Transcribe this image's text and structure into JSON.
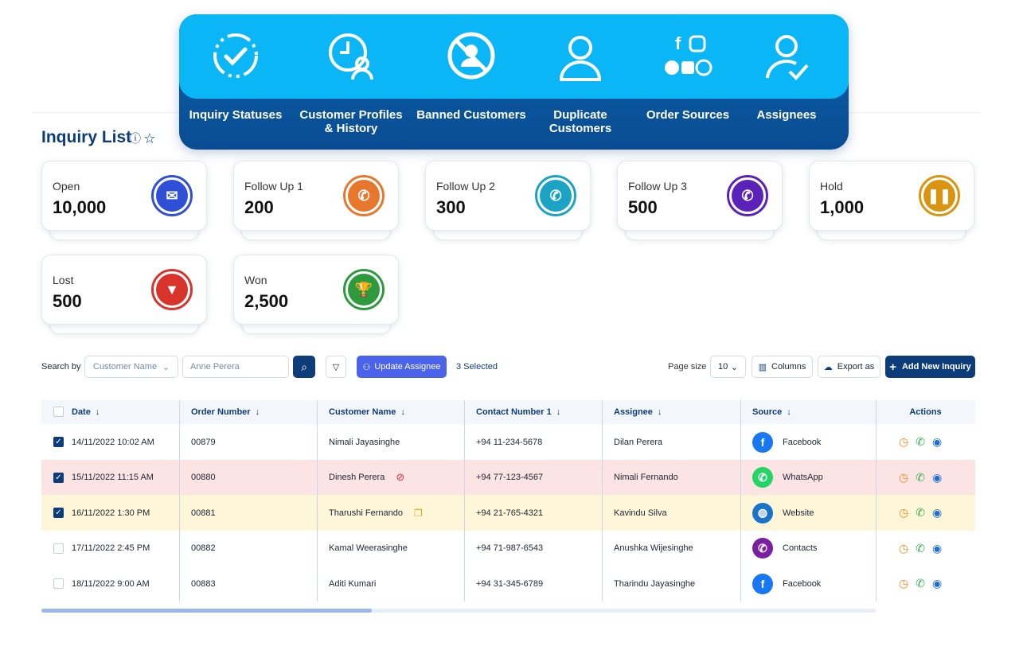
{
  "banner": {
    "items": [
      {
        "label": "Inquiry Statuses",
        "icon": "status-check-icon"
      },
      {
        "label": "Customer Profiles & History",
        "icon": "customer-history-icon"
      },
      {
        "label": "Banned Customers",
        "icon": "banned-user-icon"
      },
      {
        "label": "Duplicate Customers",
        "icon": "duplicate-user-icon"
      },
      {
        "label": "Order Sources",
        "icon": "social-sources-icon"
      },
      {
        "label": "Assignees",
        "icon": "assignee-icon"
      }
    ]
  },
  "page": {
    "title": "Inquiry List"
  },
  "cards": [
    {
      "label": "Open",
      "value": "10,000",
      "color": "#2f4fd6",
      "icon": "envelope-icon"
    },
    {
      "label": "Follow Up 1",
      "value": "200",
      "color": "#e8772e",
      "icon": "phone-icon"
    },
    {
      "label": "Follow Up 2",
      "value": "300",
      "color": "#1aa3c4",
      "icon": "phone-ring-icon"
    },
    {
      "label": "Follow Up 3",
      "value": "500",
      "color": "#5a22b8",
      "icon": "phone-ring-icon"
    },
    {
      "label": "Hold",
      "value": "1,000",
      "color": "#d99512",
      "icon": "pause-icon"
    },
    {
      "label": "Lost",
      "value": "500",
      "color": "#d8342b",
      "icon": "triangle-down-icon"
    },
    {
      "label": "Won",
      "value": "2,500",
      "color": "#2e9a3e",
      "icon": "trophy-icon"
    }
  ],
  "toolbar": {
    "search_by": "Search by",
    "search_field": "Customer Name",
    "search_value": "Anne Perera",
    "update_assignee": "Update Assignee",
    "selected": "3 Selected",
    "page_size_label": "Page size",
    "page_size": "10",
    "columns": "Columns",
    "export": "Export as",
    "add": "Add New Inquiry"
  },
  "table": {
    "headers": [
      "Date",
      "Order Number",
      "Customer Name",
      "Contact Number 1",
      "Assignee",
      "Source",
      "Actions"
    ],
    "rows": [
      {
        "date": "14/11/2022 10:02 AM",
        "order": "00879",
        "customer": "Nimali Jayasinghe",
        "contact": "+94 11-234-5678",
        "assignee": "Dilan Perera",
        "source": "Facebook",
        "checked": true,
        "bg": "#ffffff"
      },
      {
        "date": "15/11/2022 11:15 AM",
        "order": "00880",
        "customer": "Dinesh Perera",
        "contact": "+94 77-123-4567",
        "assignee": "Nimali Fernando",
        "source": "WhatsApp",
        "checked": true,
        "bg": "#fde4e4"
      },
      {
        "date": "16/11/2022 1:30 PM",
        "order": "00881",
        "customer": "Tharushi Fernando",
        "contact": "+94 21-765-4321",
        "assignee": "Kavindu Silva",
        "source": "Website",
        "checked": true,
        "bg": "#fdf6d8"
      },
      {
        "date": "17/11/2022 2:45 PM",
        "order": "00882",
        "customer": "Kamal Weerasinghe",
        "contact": "+94 71-987-6543",
        "assignee": "Anushka Wijesinghe",
        "source": "Contacts",
        "checked": false,
        "bg": "#ffffff"
      },
      {
        "date": "18/11/2022 9:00 AM",
        "order": "00883",
        "customer": "Aditi Kumari",
        "contact": "+94 31-345-6789",
        "assignee": "Tharindu Jayasinghe",
        "source": "Facebook",
        "checked": false,
        "bg": "#ffffff"
      }
    ]
  }
}
